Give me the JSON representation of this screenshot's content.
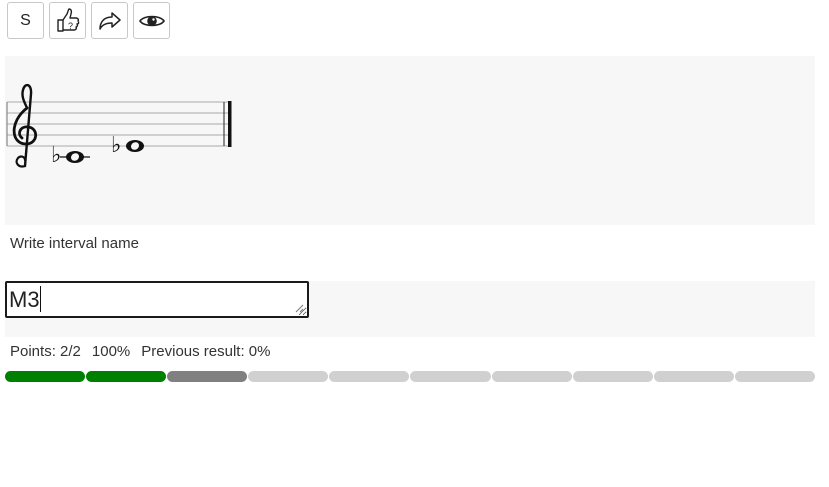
{
  "toolbar": {
    "buttons": [
      {
        "id": "s",
        "label": "S",
        "icon": "letter-s"
      },
      {
        "id": "hint",
        "icon": "thumbs-up-question-icon"
      },
      {
        "id": "share",
        "icon": "share-arrow-icon"
      },
      {
        "id": "show",
        "icon": "eye-icon"
      }
    ]
  },
  "exercise": {
    "clef": "treble",
    "notes": [
      "Eb4",
      "Gb4"
    ],
    "prompt": "Write interval name"
  },
  "answer": {
    "value": "M3"
  },
  "results": {
    "points": "Points: 2/2",
    "percent": "100%",
    "previous": "Previous result: 0%"
  },
  "progress": {
    "segments": [
      "correct",
      "correct",
      "current",
      "pending",
      "pending",
      "pending",
      "pending",
      "pending",
      "pending",
      "pending"
    ],
    "colors": {
      "correct": "#008000",
      "current": "#808080",
      "pending": "#d0d0d0"
    }
  }
}
